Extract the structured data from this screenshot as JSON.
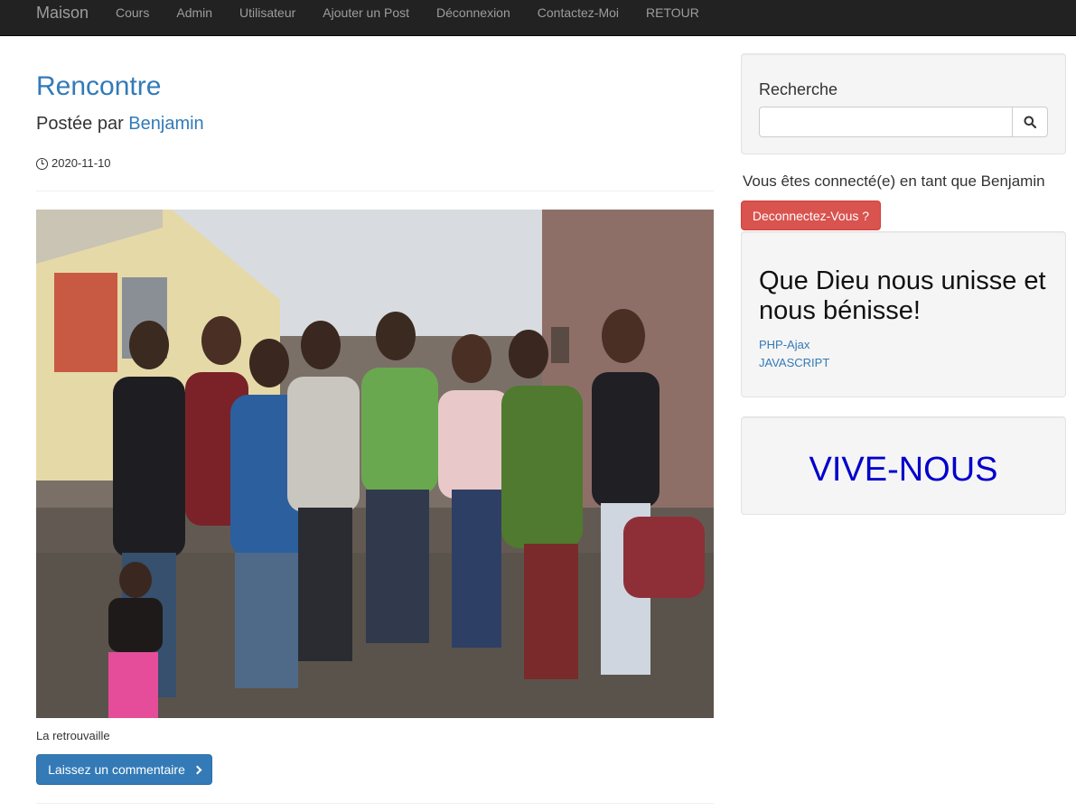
{
  "navbar": {
    "brand": "Maison",
    "links": [
      "Cours",
      "Admin",
      "Utilisateur",
      "Ajouter un Post",
      "Déconnexion",
      "Contactez-Moi",
      "RETOUR"
    ]
  },
  "post": {
    "title": "Rencontre",
    "author_prefix": "Postée par",
    "author": "Benjamin",
    "date": "2020-11-10",
    "caption": "La retrouvaille",
    "comment_button": "Laissez un commentaire"
  },
  "sidebar": {
    "search": {
      "title": "Recherche",
      "value": "",
      "placeholder": ""
    },
    "logged_in_text": "Vous êtes connecté(e) en tant que Benjamin",
    "logout_button": "Deconnectez-Vous ?",
    "motto": "Que Dieu nous unisse et nous bénisse!",
    "links": [
      "PHP-Ajax",
      "JAVASCRIPT"
    ],
    "banner": "VIVE-NOUS"
  },
  "colors": {
    "navbar_bg": "#222222",
    "link": "#337ab7",
    "danger": "#d9534f",
    "banner_text": "#0000cc"
  }
}
